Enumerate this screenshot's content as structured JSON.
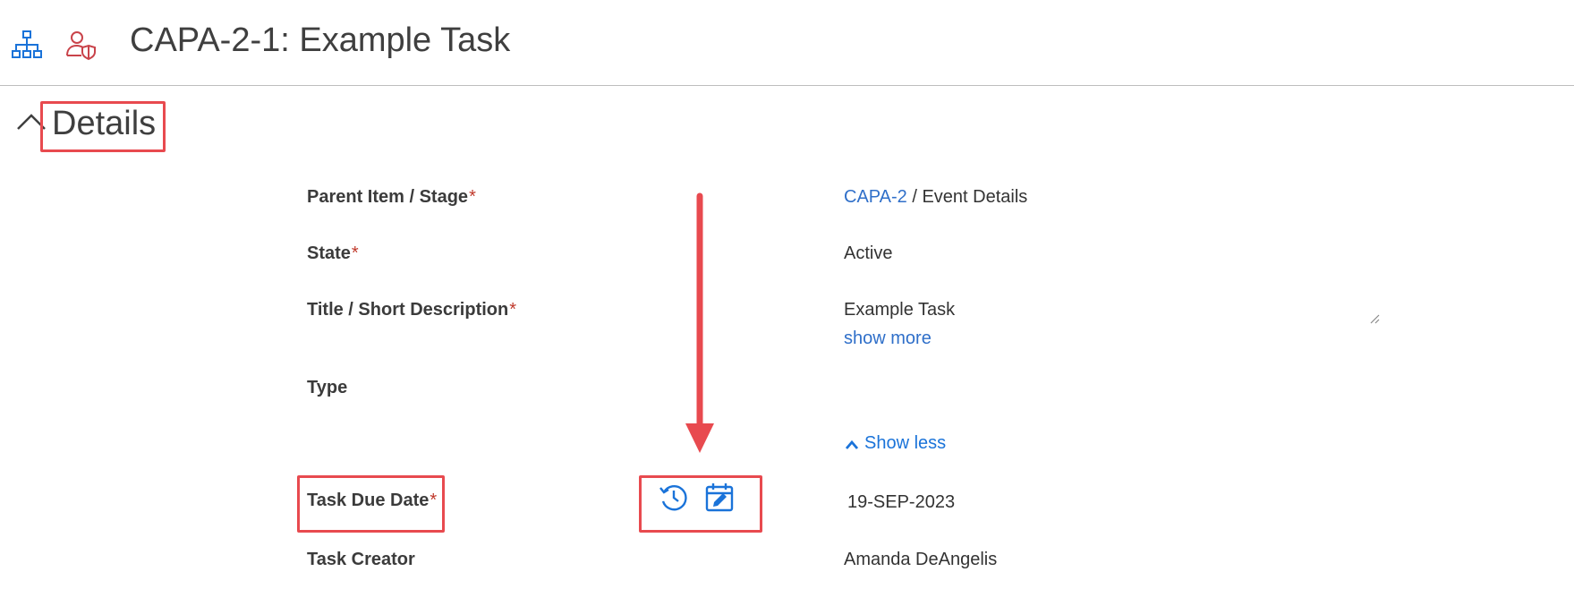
{
  "header": {
    "title": "CAPA-2-1: Example Task",
    "icons": [
      "hierarchy-icon",
      "user-shield-icon"
    ]
  },
  "section": {
    "title": "Details"
  },
  "fields": {
    "parent": {
      "label": "Parent Item / Stage",
      "required": "*",
      "link": "CAPA-2",
      "separator": " / ",
      "value": "Event Details"
    },
    "state": {
      "label": "State",
      "required": "*",
      "value": "Active"
    },
    "title": {
      "label": "Title / Short Description",
      "required": "*",
      "value": "Example Task",
      "show_more": "show more"
    },
    "type": {
      "label": "Type",
      "value": ""
    },
    "show_less": "Show less",
    "due_date": {
      "label": "Task Due Date",
      "required": "*",
      "value": "19-SEP-2023"
    },
    "creator": {
      "label": "Task Creator",
      "value": "Amanda DeAngelis"
    }
  },
  "colors": {
    "accent": "#1a73d9",
    "link": "#2f6fc9",
    "annotation": "#e84a4f",
    "required": "#c0392b"
  }
}
